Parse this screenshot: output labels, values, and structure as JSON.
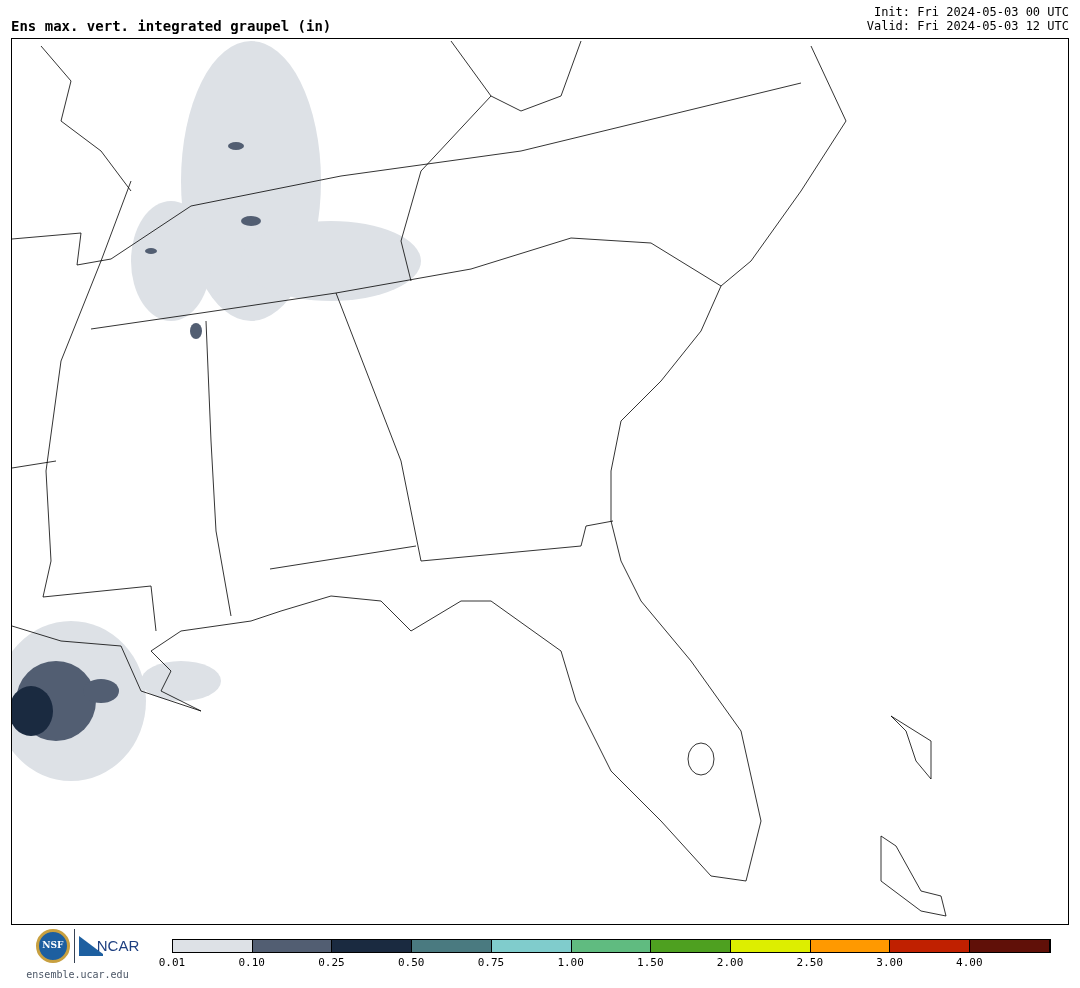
{
  "title": "Ens max. vert. integrated graupel (in)",
  "init": "Init: Fri 2024-05-03 00 UTC",
  "valid": "Valid: Fri 2024-05-03 12 UTC",
  "logos": {
    "nsf": "NSF",
    "ncar": "NCAR",
    "site": "ensemble.ucar.edu"
  },
  "colorbar": [
    {
      "label": "0.01",
      "color": "#dde1e6"
    },
    {
      "label": "0.10",
      "color": "#525e72"
    },
    {
      "label": "0.25",
      "color": "#1a2a40"
    },
    {
      "label": "0.50",
      "color": "#4a7a80"
    },
    {
      "label": "0.75",
      "color": "#80cccc"
    },
    {
      "label": "1.00",
      "color": "#60bb80"
    },
    {
      "label": "1.50",
      "color": "#4ea020"
    },
    {
      "label": "2.00",
      "color": "#ddee00"
    },
    {
      "label": "2.50",
      "color": "#ff9900"
    },
    {
      "label": "3.00",
      "color": "#c02000"
    },
    {
      "label": "4.00",
      "color": "#601008"
    }
  ]
}
